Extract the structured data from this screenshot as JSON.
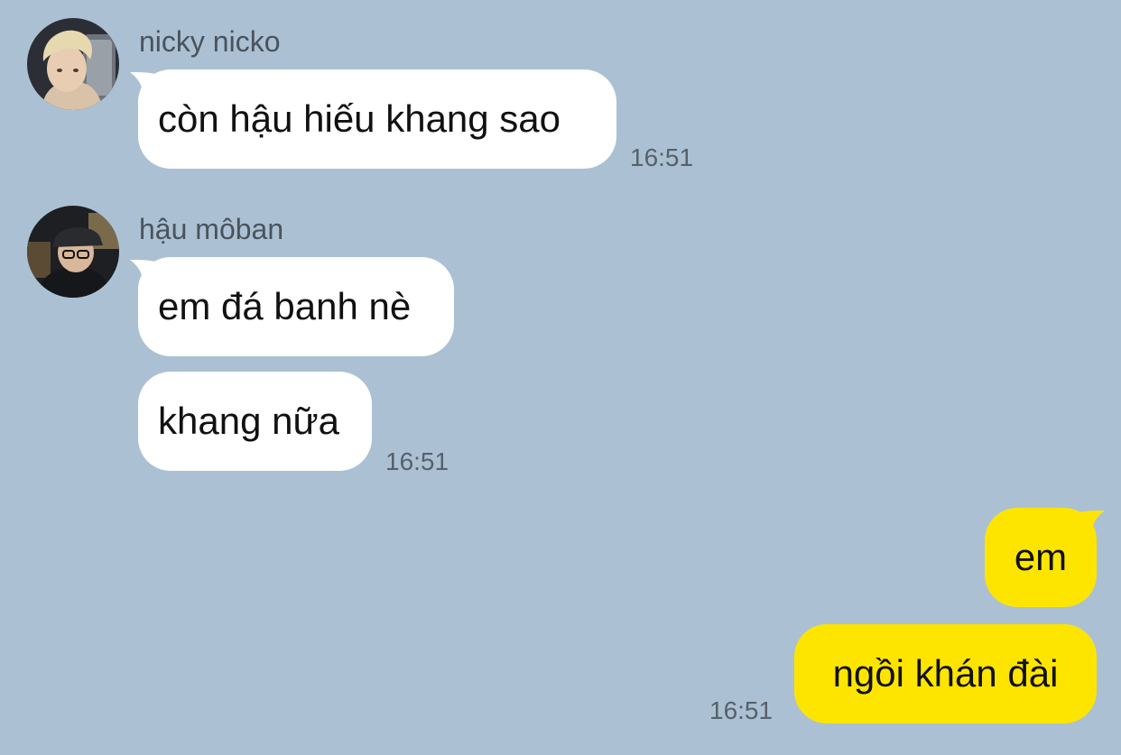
{
  "colors": {
    "background": "#abc1d3",
    "incoming_bubble": "#ffffff",
    "outgoing_bubble": "#fee500"
  },
  "messages": [
    {
      "sender": "nicky nicko",
      "avatar": "nicky-nicko-avatar",
      "texts": [
        "còn hậu hiếu khang sao"
      ],
      "time": "16:51"
    },
    {
      "sender": "hậu môban",
      "avatar": "hau-moban-avatar",
      "texts": [
        "em đá banh nè",
        "khang nữa"
      ],
      "time": "16:51"
    },
    {
      "sender": "",
      "texts": [
        "em",
        "ngồi khán đài"
      ],
      "time": "16:51"
    }
  ]
}
